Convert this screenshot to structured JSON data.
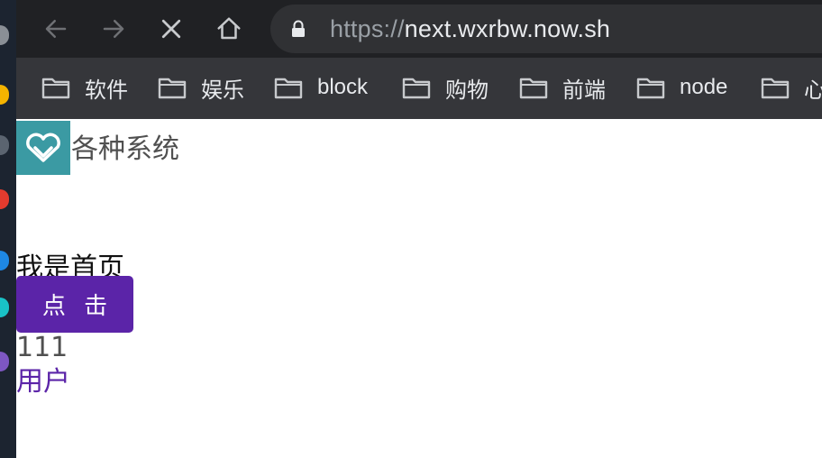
{
  "browser": {
    "url_scheme": "https://",
    "url_host": "next.wxrbw.now.sh",
    "bookmarks": [
      {
        "label": "软件"
      },
      {
        "label": "娱乐"
      },
      {
        "label": "block"
      },
      {
        "label": "购物"
      },
      {
        "label": "前端"
      },
      {
        "label": "node"
      },
      {
        "label": "心"
      }
    ]
  },
  "page": {
    "app_title": "各种系统",
    "home_text": "我是首页",
    "button_label": "点 击",
    "count": "111",
    "user_link": "用户"
  },
  "colors": {
    "toolbar": "#202124",
    "bookmarks_bar": "#35363a",
    "logo_bg": "#3b9aa3",
    "accent": "#5b24a8"
  }
}
